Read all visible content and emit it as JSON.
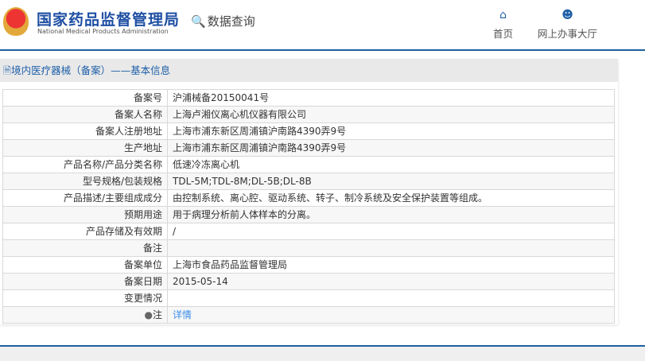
{
  "header": {
    "logo_cn": "国家药品监督管理局",
    "logo_en": "National Medical Products Administration",
    "data_query": "数据查询",
    "nav": [
      {
        "label": "首页",
        "icon": "home-icon"
      },
      {
        "label": "网上办事大厅",
        "icon": "user-icon"
      }
    ]
  },
  "panel": {
    "title": "境内医疗器械（备案）——基本信息",
    "rows": [
      {
        "label": "备案号",
        "value": "沪浦械备20150041号"
      },
      {
        "label": "备案人名称",
        "value": "上海卢湘仪离心机仪器有限公司"
      },
      {
        "label": "备案人注册地址",
        "value": "上海市浦东新区周浦镇沪南路4390弄9号"
      },
      {
        "label": "生产地址",
        "value": "上海市浦东新区周浦镇沪南路4390弄9号"
      },
      {
        "label": "产品名称/产品分类名称",
        "value": "低速冷冻离心机"
      },
      {
        "label": "型号规格/包装规格",
        "value": "TDL-5M;TDL-8M;DL-5B;DL-8B"
      },
      {
        "label": "产品描述/主要组成成分",
        "value": "由控制系统、离心腔、驱动系统、转子、制冷系统及安全保护装置等组成。"
      },
      {
        "label": "预期用途",
        "value": "用于病理分析前人体样本的分离。"
      },
      {
        "label": "产品存储及有效期",
        "value": "/"
      },
      {
        "label": "备注",
        "value": ""
      },
      {
        "label": "备案单位",
        "value": "上海市食品药品监督管理局"
      },
      {
        "label": "备案日期",
        "value": "2015-05-14"
      },
      {
        "label": "变更情况",
        "value": ""
      }
    ],
    "note_label": "注",
    "note_link": "详情"
  }
}
